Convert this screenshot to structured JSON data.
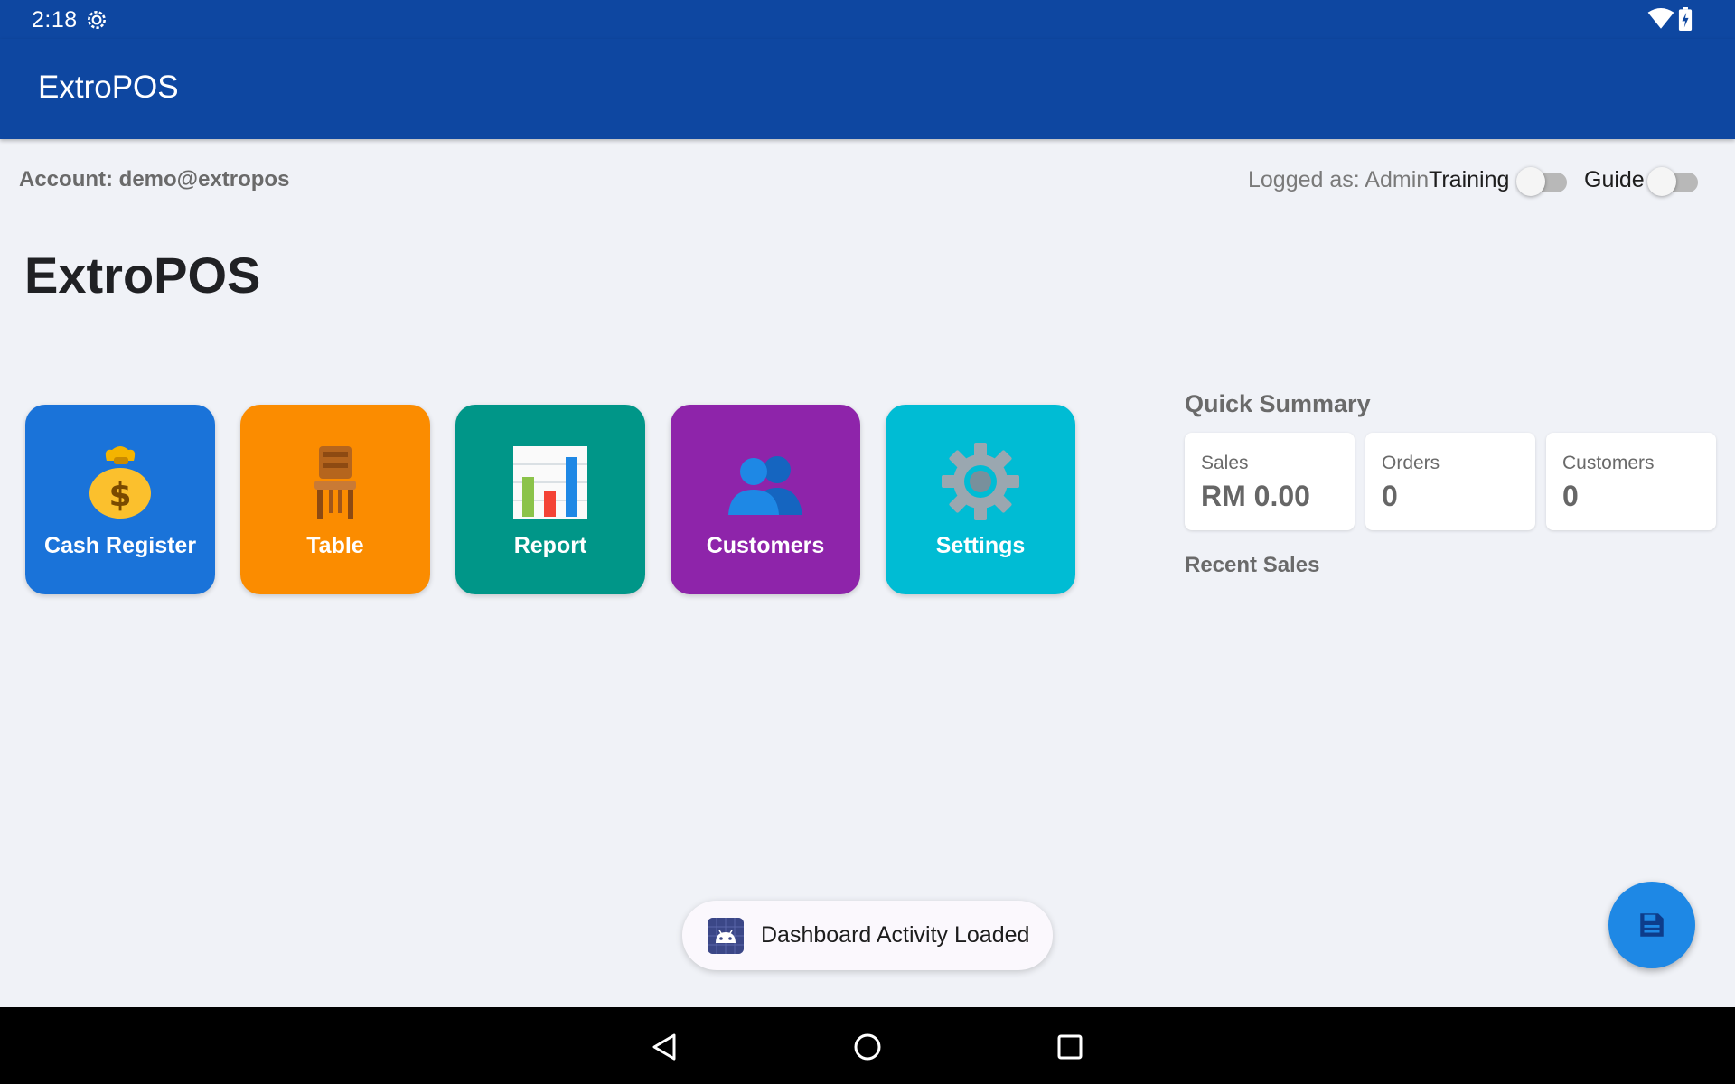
{
  "status_bar": {
    "time": "2:18"
  },
  "app_bar": {
    "title": "ExtroPOS"
  },
  "account": {
    "text": "Account: demo@extropos"
  },
  "user": {
    "logged_as": "Logged as: Admin"
  },
  "toggles": {
    "training": {
      "label": "Training",
      "on": false
    },
    "guide": {
      "label": "Guide",
      "on": false
    }
  },
  "page_title": "ExtroPOS",
  "tiles": [
    {
      "label": "Cash Register",
      "icon": "money-bag-icon",
      "color": "#1a73d9"
    },
    {
      "label": "Table",
      "icon": "chair-icon",
      "color": "#fb8c00"
    },
    {
      "label": "Report",
      "icon": "bar-chart-icon",
      "color": "#009688"
    },
    {
      "label": "Customers",
      "icon": "people-icon",
      "color": "#8e24aa"
    },
    {
      "label": "Settings",
      "icon": "gear-icon",
      "color": "#00bcd4"
    }
  ],
  "quick_summary": {
    "title": "Quick Summary",
    "cards": [
      {
        "label": "Sales",
        "value": "RM 0.00"
      },
      {
        "label": "Orders",
        "value": "0"
      },
      {
        "label": "Customers",
        "value": "0"
      }
    ]
  },
  "recent_sales": {
    "title": "Recent Sales"
  },
  "toast": {
    "text": "Dashboard Activity Loaded",
    "icon": "android-icon"
  },
  "fab": {
    "icon": "save-icon"
  },
  "colors": {
    "primary": "#0e47a1",
    "fab": "#1e88e5",
    "background": "#f0f2f7"
  }
}
